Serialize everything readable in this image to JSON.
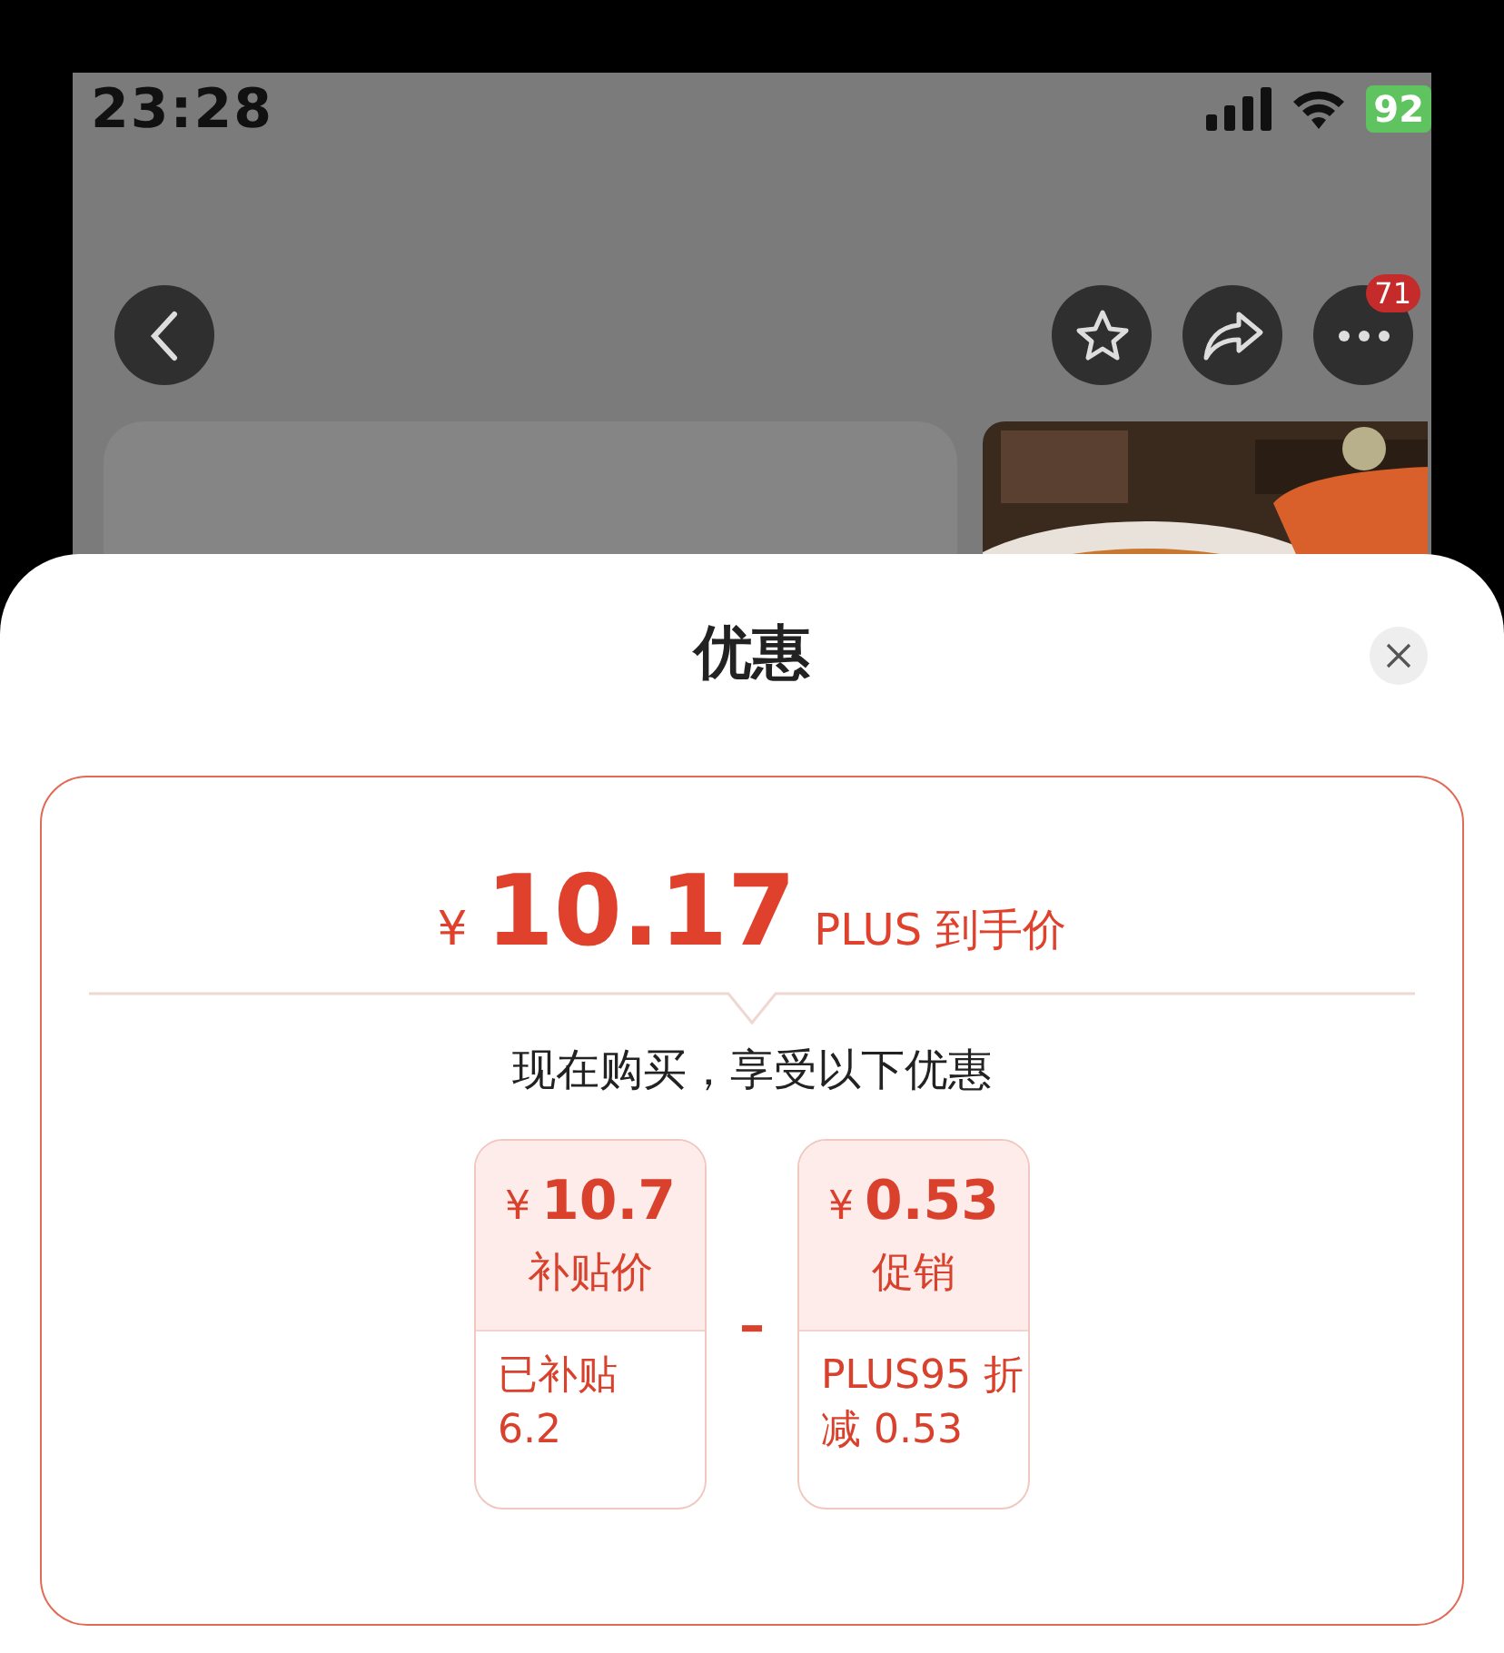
{
  "status_bar": {
    "time": "23:28",
    "battery": "92"
  },
  "nav": {
    "more_badge": "71"
  },
  "sheet": {
    "title": "优惠",
    "price": {
      "currency": "¥",
      "amount": "10.17",
      "label": "PLUS 到手价"
    },
    "subtitle": "现在购买，享受以下优惠",
    "operator": "–",
    "cards": [
      {
        "currency": "¥",
        "amount": "10.7",
        "label": "补贴价",
        "detail_lines": [
          "已补贴",
          "6.2"
        ]
      },
      {
        "currency": "¥",
        "amount": "0.53",
        "label": "促销",
        "detail_lines": [
          "PLUS95 折",
          "减 0.53"
        ]
      }
    ]
  }
}
